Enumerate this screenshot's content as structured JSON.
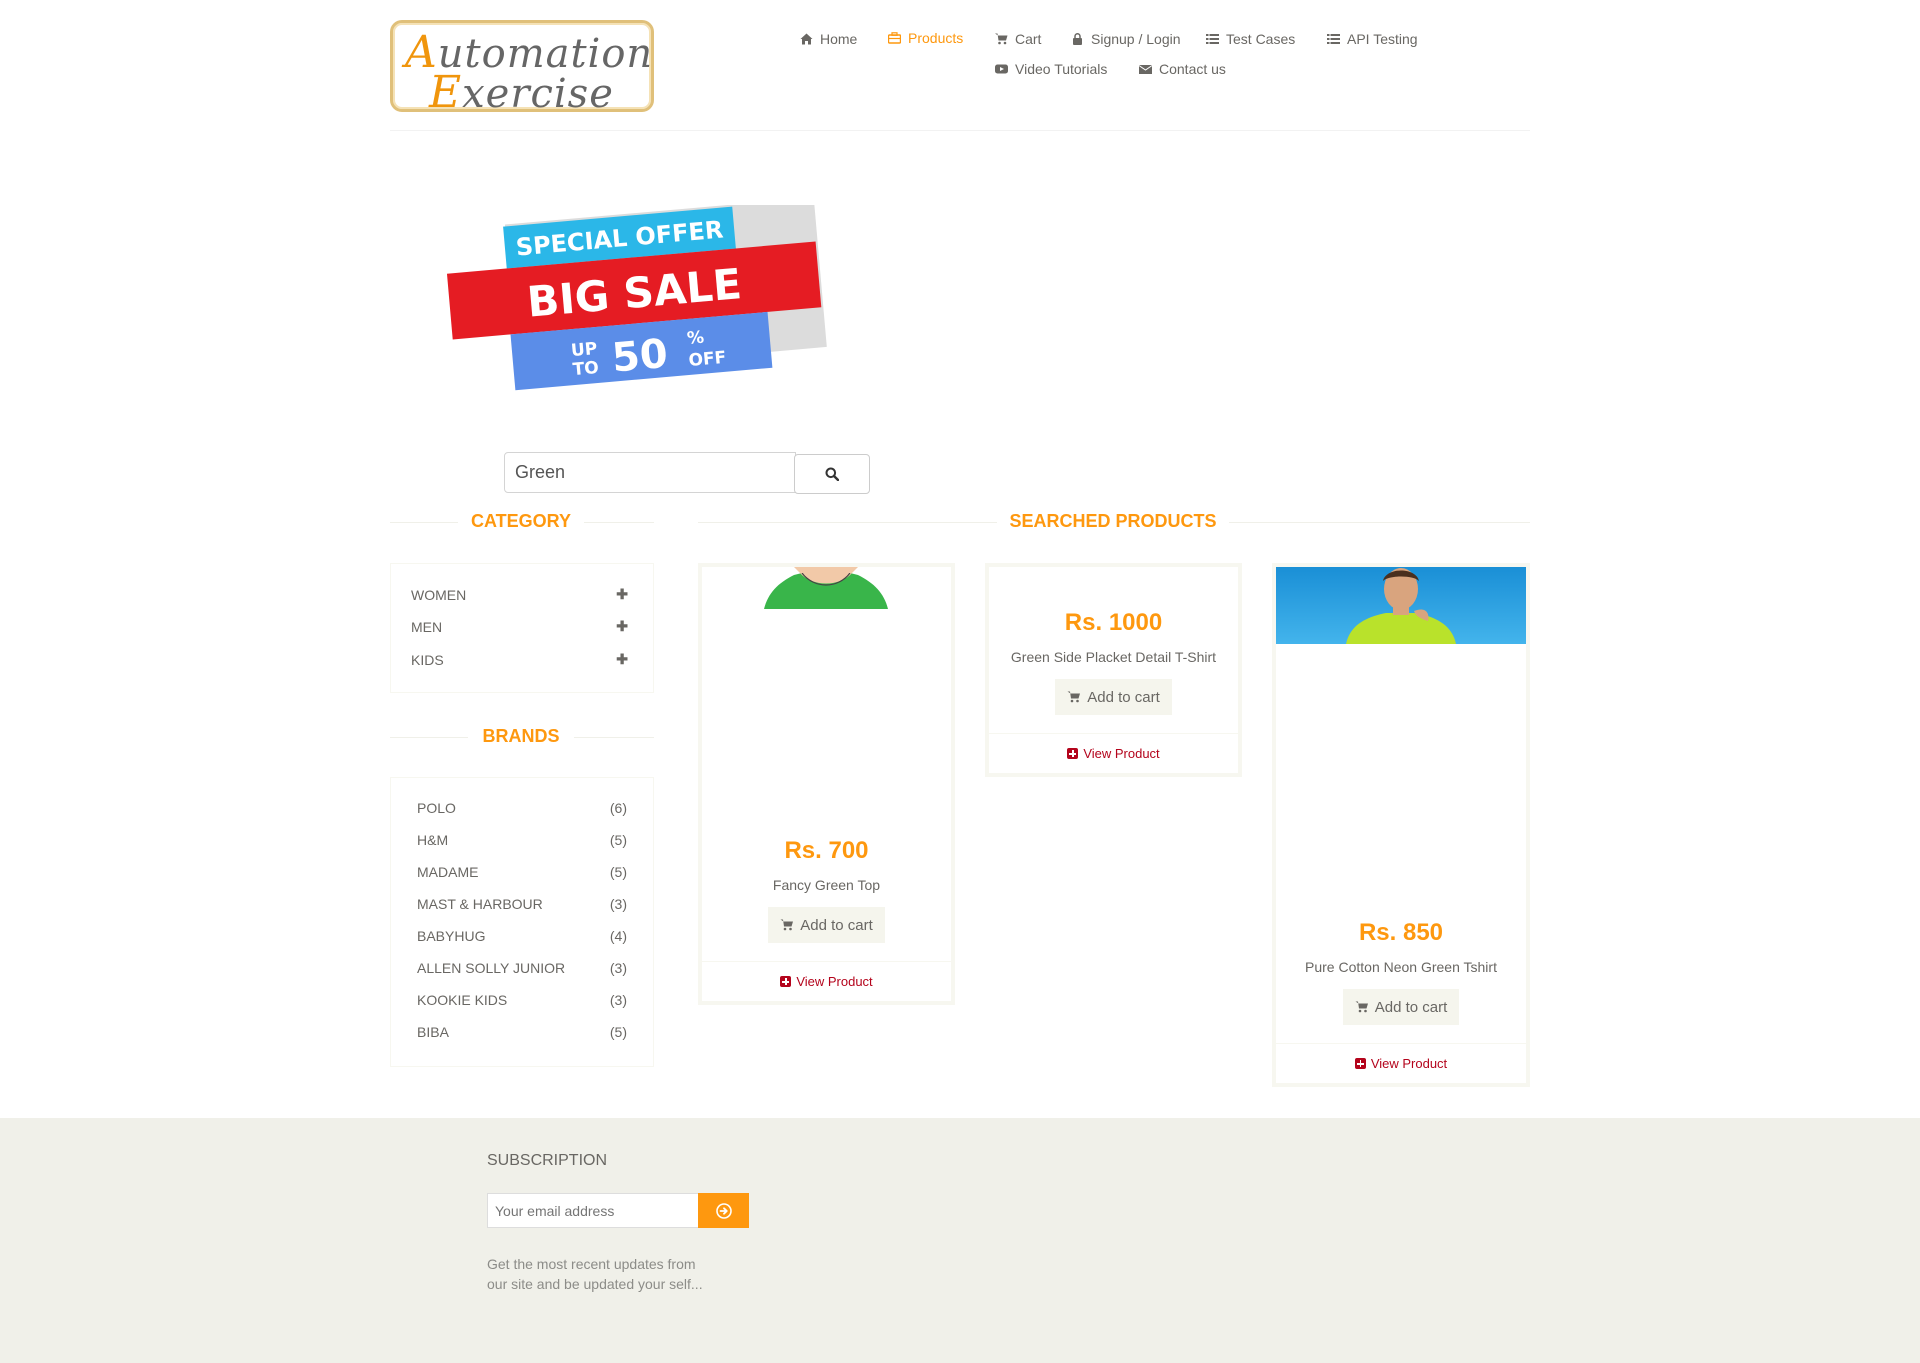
{
  "header": {
    "logo_first_line": "utomation",
    "logo_first_cap": "A",
    "logo_second_line": "xercise",
    "logo_second_cap": "E",
    "nav": [
      {
        "label": "Home",
        "icon": "home-icon"
      },
      {
        "label": "Products",
        "icon": "products-icon",
        "active": true
      },
      {
        "label": "Cart",
        "icon": "cart-icon"
      },
      {
        "label": "Signup / Login",
        "icon": "lock-icon"
      },
      {
        "label": "Test Cases",
        "icon": "list-icon"
      },
      {
        "label": "API Testing",
        "icon": "list-icon"
      },
      {
        "label": "Video Tutorials",
        "icon": "youtube-play-icon"
      },
      {
        "label": "Contact us",
        "icon": "envelope-icon"
      }
    ]
  },
  "banner": {
    "special_offer": "SPECIAL OFFER",
    "big_sale": "BIG SALE",
    "up": "UP",
    "to": "TO",
    "percent": "50",
    "percent_sign": "%",
    "off": "OFF"
  },
  "search": {
    "value": "Green"
  },
  "sidebar": {
    "category_title": "CATEGORY",
    "categories": [
      "WOMEN",
      "MEN",
      "KIDS"
    ],
    "brands_title": "BRANDS",
    "brands": [
      {
        "name": "POLO",
        "count": "(6)"
      },
      {
        "name": "H&M",
        "count": "(5)"
      },
      {
        "name": "MADAME",
        "count": "(5)"
      },
      {
        "name": "MAST & HARBOUR",
        "count": "(3)"
      },
      {
        "name": "BABYHUG",
        "count": "(4)"
      },
      {
        "name": "ALLEN SOLLY JUNIOR",
        "count": "(3)"
      },
      {
        "name": "KOOKIE KIDS",
        "count": "(3)"
      },
      {
        "name": "BIBA",
        "count": "(5)"
      }
    ]
  },
  "products": {
    "title": "SEARCHED PRODUCTS",
    "items": [
      {
        "price": "Rs. 700",
        "name": "Fancy Green Top",
        "add_label": "Add to cart",
        "view_label": "View Product"
      },
      {
        "price": "Rs. 1000",
        "name": "Green Side Placket Detail T-Shirt",
        "add_label": "Add to cart",
        "view_label": "View Product"
      },
      {
        "price": "Rs. 850",
        "name": "Pure Cotton Neon Green Tshirt",
        "add_label": "Add to cart",
        "view_label": "View Product"
      }
    ]
  },
  "footer": {
    "subscription_title": "SUBSCRIPTION",
    "email_placeholder": "Your email address",
    "description": "Get the most recent updates from our site and be updated your self..."
  },
  "colors": {
    "accent": "#FE980F",
    "text": "#696763",
    "view_link": "#B4041C",
    "footer_bg": "#F0F0E9"
  }
}
